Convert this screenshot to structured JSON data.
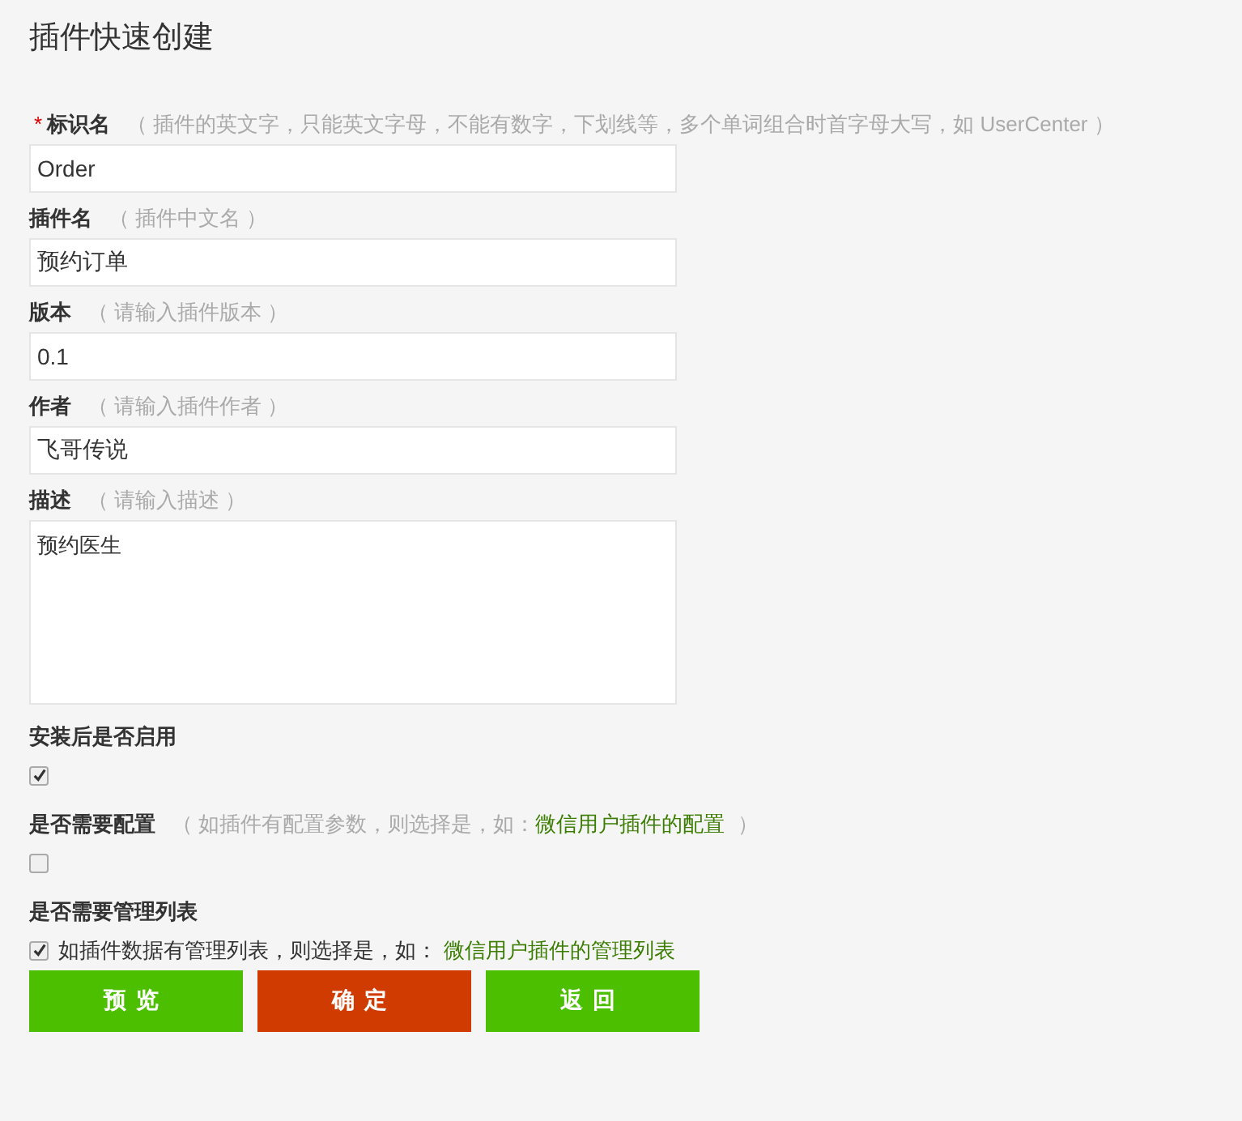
{
  "title": "插件快速创建",
  "fields": [
    {
      "kind": "text",
      "required_mark": "*",
      "label": "标识名",
      "hint": "（ 插件的英文字，只能英文字母，不能有数字，下划线等，多个单词组合时首字母大写，如 UserCenter ）",
      "value": "Order"
    },
    {
      "kind": "text",
      "label": "插件名",
      "hint": "（ 插件中文名 ）",
      "value": "预约订单"
    },
    {
      "kind": "text",
      "label": "版本",
      "hint": "（ 请输入插件版本 ）",
      "value": "0.1"
    },
    {
      "kind": "text",
      "label": "作者",
      "hint": "（ 请输入插件作者 ）",
      "value": "飞哥传说"
    },
    {
      "kind": "textarea",
      "label": "描述",
      "hint": "（ 请输入描述 ）",
      "value": "预约医生"
    }
  ],
  "options": [
    {
      "label": "安装后是否启用",
      "checked": true
    },
    {
      "label": "是否需要配置",
      "hint": "（ 如插件有配置参数，则选择是，如：",
      "link": "微信用户插件的配置",
      "hint_end": "）",
      "checked": false
    },
    {
      "label": "是否需要管理列表",
      "checked": true,
      "check_text": "如插件数据有管理列表，则选择是，如：",
      "check_link": "微信用户插件的管理列表"
    }
  ],
  "buttons": [
    {
      "label": "预览",
      "color": "#4cbf00"
    },
    {
      "label": "确定",
      "color": "#cf3b00"
    },
    {
      "label": "返回",
      "color": "#4cbf00"
    }
  ]
}
